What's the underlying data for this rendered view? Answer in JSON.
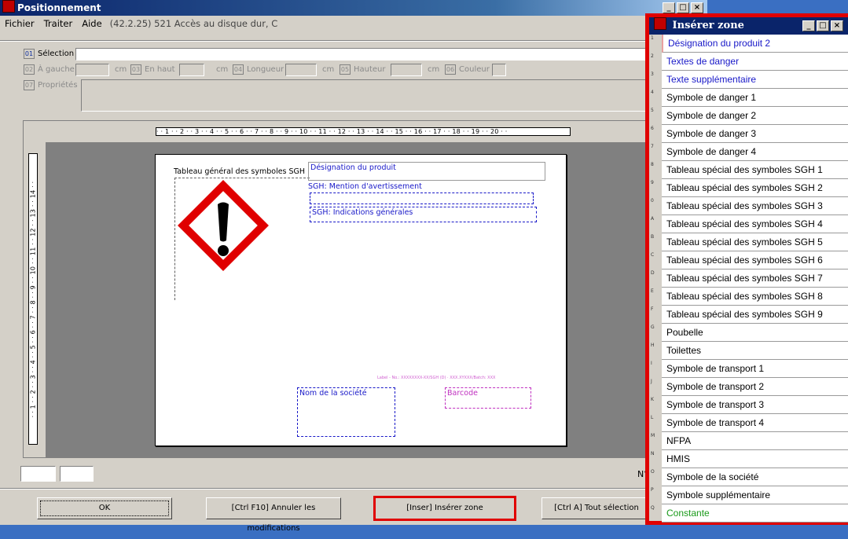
{
  "window": {
    "title": "Positionnement"
  },
  "menu": {
    "items": [
      "Fichier",
      "Traiter",
      "Aide"
    ],
    "info": "(42.2.25) 521 Accès au disque dur, C"
  },
  "toolbar": {
    "sel_num": "01",
    "sel_label": "Sélection",
    "sel_value": "",
    "row2": [
      {
        "num": "02",
        "label": "À gauche",
        "unit": "cm"
      },
      {
        "num": "03",
        "label": "En haut",
        "unit": "cm"
      },
      {
        "num": "04",
        "label": "Longueur",
        "unit": "cm"
      },
      {
        "num": "05",
        "label": "Hauteur",
        "unit": "cm"
      },
      {
        "num": "06",
        "label": "Couleur",
        "unit": ""
      }
    ],
    "prop_num": "07",
    "prop_label": "Propriétés"
  },
  "ruler": {
    "h_text": "· · 1 · · 2 · · 3 · · 4 · · 5 · · 6 · · 7 · · 8 · · 9 · · 10 · · 11 · · 12 · · 13 · · 14 · · 15 · · 16 · · 17 · · 18 · · 19 · · 20 · ·",
    "v_text": "· · 1 · · 2 · · 3 · · 4 · · 5 · · 6 · · 7 · · 8 · · 9 · · 10 · · 11 · · 12 · · 13 · · 14 · ·"
  },
  "label": {
    "sgh_table": "Tableau général des symboles SGH",
    "designation": "Désignation du produit",
    "mention": "SGH: Mention d'avertissement",
    "indications": "SGH: Indications générales",
    "footer_line": "Label - No.: XXXXXXXX-XX/SGH (D) · XXX.XYXXX/Batch: XXX",
    "company": "Nom de la société",
    "barcode": "Barcode",
    "colors": {
      "zone": "#1818c8",
      "magenta": "#c030c0",
      "hazard": "#e00000"
    }
  },
  "status": {
    "n_label": "N°"
  },
  "buttons": {
    "ok": "OK",
    "cancel": "[Ctrl F10] Annuler les modifications",
    "insert": "[Inser] Insérer zone",
    "select_all": "[Ctrl A] Tout sélection"
  },
  "panel": {
    "title": "Insérer zone",
    "items": [
      {
        "key": "1",
        "label": "Désignation du produit 2",
        "color": "#1818c8"
      },
      {
        "key": "2",
        "label": "Textes de danger",
        "color": "#1818c8"
      },
      {
        "key": "3",
        "label": "Texte supplémentaire",
        "color": "#1818c8"
      },
      {
        "key": "4",
        "label": "Symbole de danger 1",
        "color": "#000000"
      },
      {
        "key": "5",
        "label": "Symbole de danger 2",
        "color": "#000000"
      },
      {
        "key": "6",
        "label": "Symbole de danger 3",
        "color": "#000000"
      },
      {
        "key": "7",
        "label": "Symbole de danger 4",
        "color": "#000000"
      },
      {
        "key": "8",
        "label": "Tableau spécial des symboles SGH 1",
        "color": "#000000"
      },
      {
        "key": "9",
        "label": "Tableau spécial des symboles SGH 2",
        "color": "#000000"
      },
      {
        "key": "0",
        "label": "Tableau spécial des symboles SGH 3",
        "color": "#000000"
      },
      {
        "key": "A",
        "label": "Tableau spécial des symboles SGH 4",
        "color": "#000000"
      },
      {
        "key": "B",
        "label": "Tableau spécial des symboles SGH 5",
        "color": "#000000"
      },
      {
        "key": "C",
        "label": "Tableau spécial des symboles SGH 6",
        "color": "#000000"
      },
      {
        "key": "D",
        "label": "Tableau spécial des symboles SGH 7",
        "color": "#000000"
      },
      {
        "key": "E",
        "label": "Tableau spécial des symboles SGH 8",
        "color": "#000000"
      },
      {
        "key": "F",
        "label": "Tableau spécial des symboles SGH 9",
        "color": "#000000"
      },
      {
        "key": "G",
        "label": "Poubelle",
        "color": "#000000"
      },
      {
        "key": "H",
        "label": "Toilettes",
        "color": "#000000"
      },
      {
        "key": "I",
        "label": "Symbole de transport 1",
        "color": "#000000"
      },
      {
        "key": "J",
        "label": "Symbole de transport 2",
        "color": "#000000"
      },
      {
        "key": "K",
        "label": "Symbole de transport 3",
        "color": "#000000"
      },
      {
        "key": "L",
        "label": "Symbole de transport 4",
        "color": "#000000"
      },
      {
        "key": "M",
        "label": "NFPA",
        "color": "#000000"
      },
      {
        "key": "N",
        "label": "HMIS",
        "color": "#000000"
      },
      {
        "key": "O",
        "label": "Symbole de la société",
        "color": "#000000"
      },
      {
        "key": "P",
        "label": "Symbole supplémentaire",
        "color": "#000000"
      },
      {
        "key": "Q",
        "label": "Constante",
        "color": "#1a9a1a"
      }
    ]
  }
}
